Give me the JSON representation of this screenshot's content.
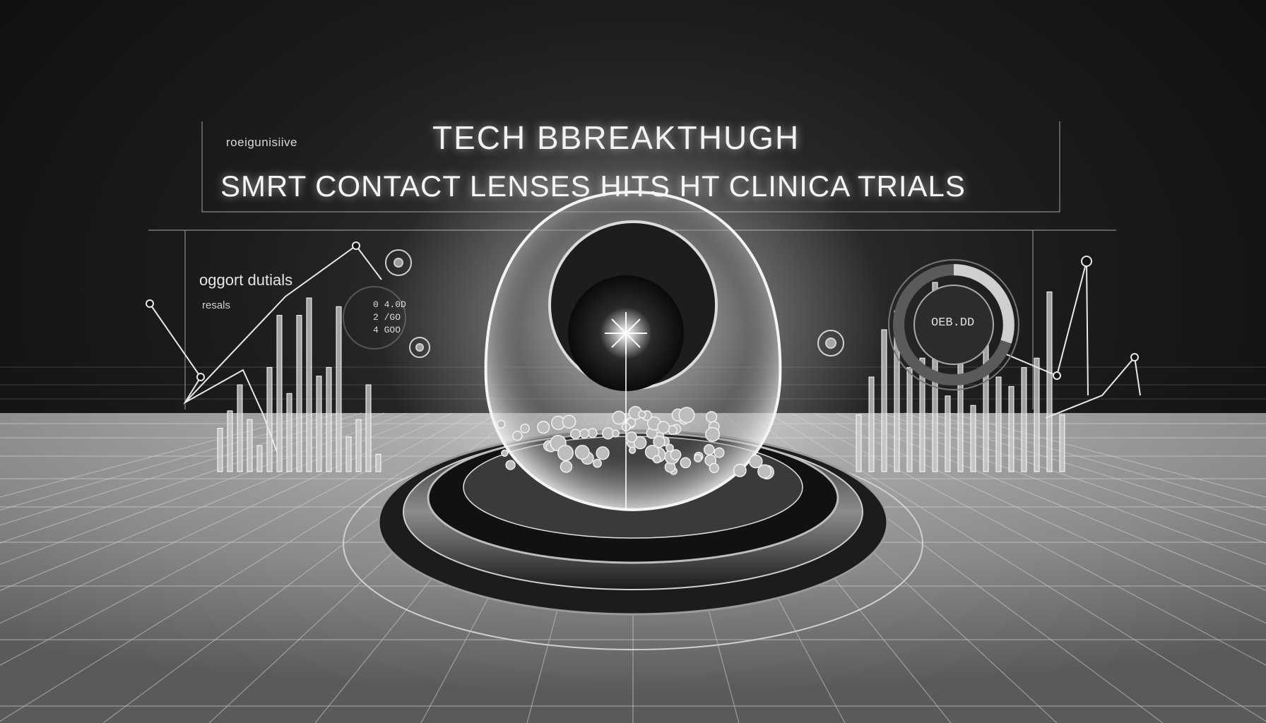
{
  "header": {
    "kicker": "roeigunisiive",
    "headline": "TECH BBREAKTHUGH",
    "subheadline": "SMRT CONTACT LENSES HITS HT CLINICA TRIALS"
  },
  "left_panel": {
    "label": "oggort dutials",
    "sublabel": "resals",
    "readouts": [
      "0 4.0D",
      "2 /GO",
      "4 GOO"
    ]
  },
  "right_panel": {
    "gauge_text": "OEB.DD"
  },
  "bar_groups": {
    "left": [
      0.25,
      0.35,
      0.5,
      0.3,
      0.15,
      0.6,
      0.9,
      0.45,
      0.9,
      1.0,
      0.55,
      0.6,
      0.95,
      0.2,
      0.3,
      0.5,
      0.1
    ],
    "right": [
      0.3,
      0.5,
      0.75,
      0.85,
      0.55,
      0.6,
      1.0,
      0.4,
      0.65,
      0.35,
      0.8,
      0.5,
      0.45,
      0.55,
      0.6,
      0.95,
      0.3
    ]
  },
  "colors": {
    "background": "#1a1a1a",
    "glow": "#ffffff",
    "grid": "#9a9a9a"
  }
}
